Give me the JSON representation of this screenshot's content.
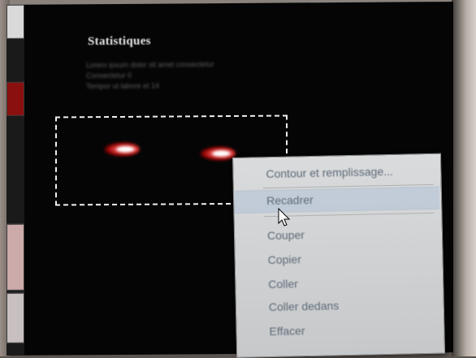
{
  "panel": {
    "title": "Statistiques",
    "lines": [
      "Lorem ipsum dolor sit amet consectetur",
      "Consectetur 0",
      "Tempor ut labore et 14"
    ]
  },
  "context_menu": {
    "items": [
      {
        "label": "Contour et remplissage..."
      },
      {
        "label": "Recadrer"
      },
      {
        "label": "Couper"
      },
      {
        "label": "Copier"
      },
      {
        "label": "Coller"
      },
      {
        "label": "Coller dedans"
      },
      {
        "label": "Effacer"
      }
    ]
  },
  "icons": {
    "cursor": "pointer-cursor-icon"
  },
  "colors": {
    "canvas": "#050505",
    "menu_bg": "#d9dbdc",
    "menu_text": "#5e6a78",
    "selection": "#f0f0f0"
  }
}
